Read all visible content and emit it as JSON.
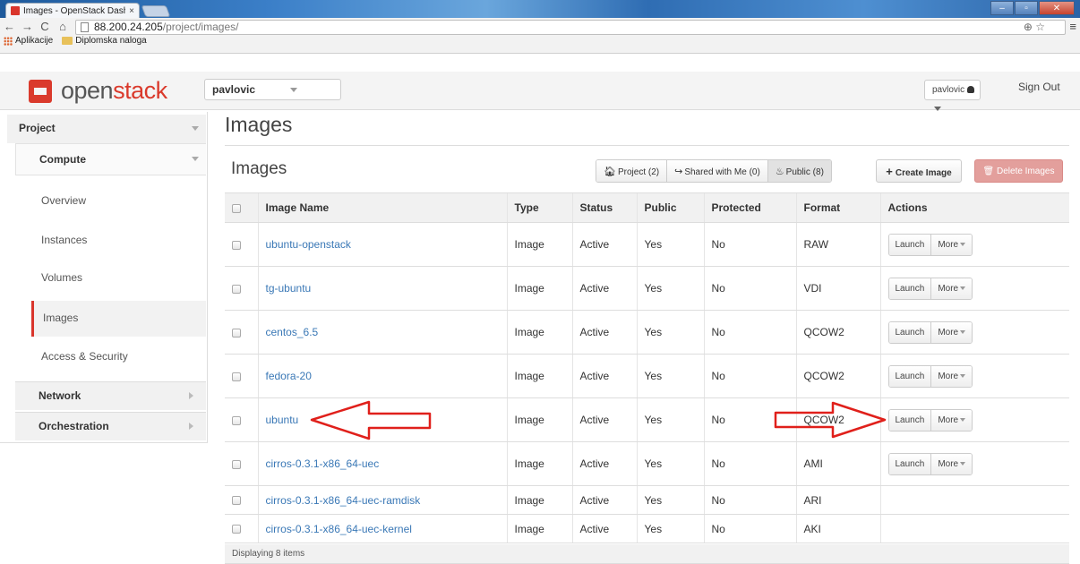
{
  "browser": {
    "tab_title": "Images - OpenStack Dash",
    "tab_close": "×",
    "url_host": "88.200.24.205",
    "url_path": "/project/images/",
    "bookmarks": [
      "Aplikacije",
      "Diplomska naloga"
    ]
  },
  "topbar": {
    "logo_left": "open",
    "logo_right": "stack",
    "project": "pavlovic",
    "user": "pavlovic",
    "sign_out": "Sign Out"
  },
  "sidebar": {
    "project": "Project",
    "compute": "Compute",
    "items": [
      "Overview",
      "Instances",
      "Volumes",
      "Images",
      "Access & Security"
    ],
    "active": "Images",
    "network": "Network",
    "orchestration": "Orchestration"
  },
  "page": {
    "title": "Images",
    "section_title": "Images",
    "filters": {
      "project": "Project (2)",
      "shared": "Shared with Me (0)",
      "public": "Public (8)"
    },
    "create_label": "Create Image",
    "delete_label": "Delete Images"
  },
  "table": {
    "headers": [
      "Image Name",
      "Type",
      "Status",
      "Public",
      "Protected",
      "Format",
      "Actions"
    ],
    "launch_label": "Launch",
    "more_label": "More",
    "rows": [
      {
        "name": "ubuntu-openstack",
        "type": "Image",
        "status": "Active",
        "public": "Yes",
        "protected": "No",
        "format": "RAW"
      },
      {
        "name": "tg-ubuntu",
        "type": "Image",
        "status": "Active",
        "public": "Yes",
        "protected": "No",
        "format": "VDI"
      },
      {
        "name": "centos_6.5",
        "type": "Image",
        "status": "Active",
        "public": "Yes",
        "protected": "No",
        "format": "QCOW2"
      },
      {
        "name": "fedora-20",
        "type": "Image",
        "status": "Active",
        "public": "Yes",
        "protected": "No",
        "format": "QCOW2"
      },
      {
        "name": "ubuntu",
        "type": "Image",
        "status": "Active",
        "public": "Yes",
        "protected": "No",
        "format": "QCOW2"
      },
      {
        "name": "cirros-0.3.1-x86_64-uec",
        "type": "Image",
        "status": "Active",
        "public": "Yes",
        "protected": "No",
        "format": "AMI"
      },
      {
        "name": "cirros-0.3.1-x86_64-uec-ramdisk",
        "type": "Image",
        "status": "Active",
        "public": "Yes",
        "protected": "No",
        "format": "ARI"
      },
      {
        "name": "cirros-0.3.1-x86_64-uec-kernel",
        "type": "Image",
        "status": "Active",
        "public": "Yes",
        "protected": "No",
        "format": "AKI"
      }
    ],
    "footer": "Displaying 8 items"
  },
  "colors": {
    "accent": "#d9352c",
    "link": "#3a78b6",
    "annotation": "#e0201b"
  }
}
